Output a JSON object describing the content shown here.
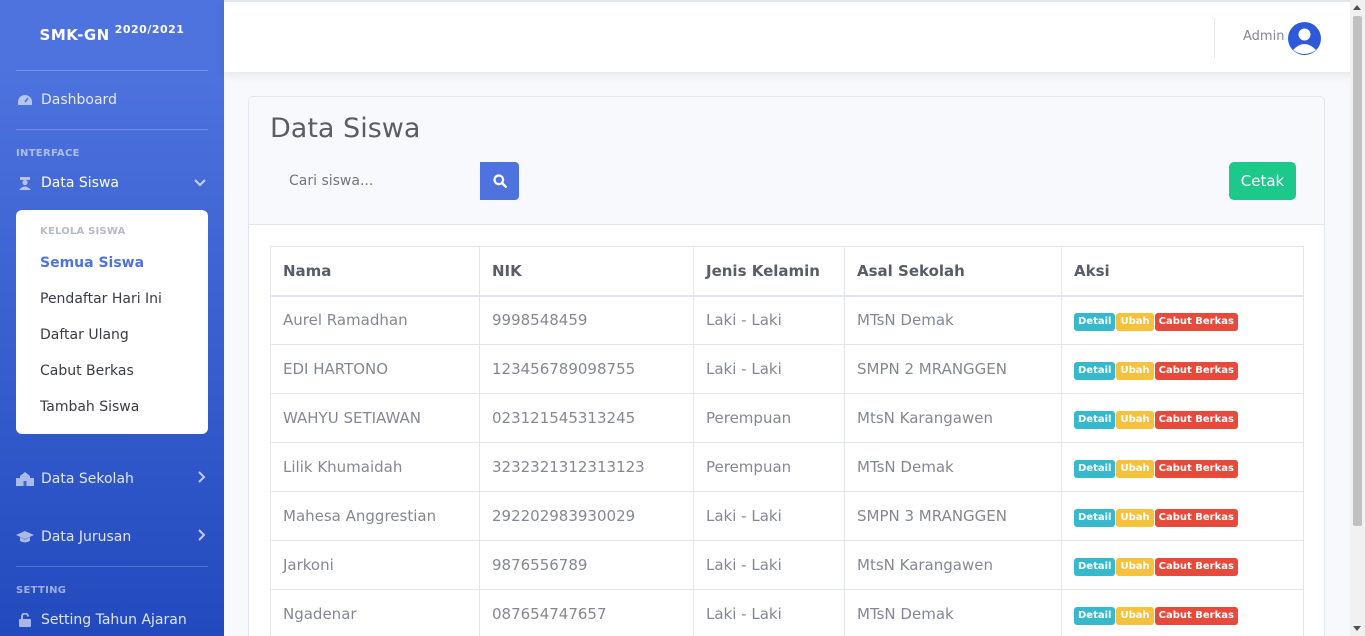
{
  "brand": {
    "name": "SMK-GN",
    "year": "2020/2021"
  },
  "sidebar": {
    "dashboard": "Dashboard",
    "heading_interface": "INTERFACE",
    "data_siswa": "Data Siswa",
    "submenu_header": "KELOLA SISWA",
    "submenu": [
      "Semua Siswa",
      "Pendaftar Hari Ini",
      "Daftar Ulang",
      "Cabut Berkas",
      "Tambah Siswa"
    ],
    "data_sekolah": "Data Sekolah",
    "data_jurusan": "Data Jurusan",
    "heading_setting": "SETTING",
    "setting_tahun": "Setting Tahun Ajaran"
  },
  "topbar": {
    "user": "Admin"
  },
  "main": {
    "title": "Data Siswa",
    "search_placeholder": "Cari siswa...",
    "print_label": "Cetak",
    "columns": [
      "Nama",
      "NIK",
      "Jenis Kelamin",
      "Asal Sekolah",
      "Aksi"
    ],
    "actions": {
      "detail": "Detail",
      "edit": "Ubah",
      "revoke": "Cabut Berkas"
    },
    "rows": [
      [
        "Aurel Ramadhan",
        "9998548459",
        "Laki - Laki",
        "MTsN Demak"
      ],
      [
        "EDI HARTONO",
        "123456789098755",
        "Laki - Laki",
        "SMPN 2 MRANGGEN"
      ],
      [
        "WAHYU SETIAWAN",
        "023121545313245",
        "Perempuan",
        "MtsN Karangawen"
      ],
      [
        "Lilik Khumaidah",
        "3232321312313123",
        "Perempuan",
        "MTsN Demak"
      ],
      [
        "Mahesa Anggrestian",
        "292202983930029",
        "Laki - Laki",
        "SMPN 3 MRANGGEN"
      ],
      [
        "Jarkoni",
        "9876556789",
        "Laki - Laki",
        "MtsN Karangawen"
      ],
      [
        "Ngadenar",
        "087654747657",
        "Laki - Laki",
        "MTsN Demak"
      ]
    ]
  }
}
